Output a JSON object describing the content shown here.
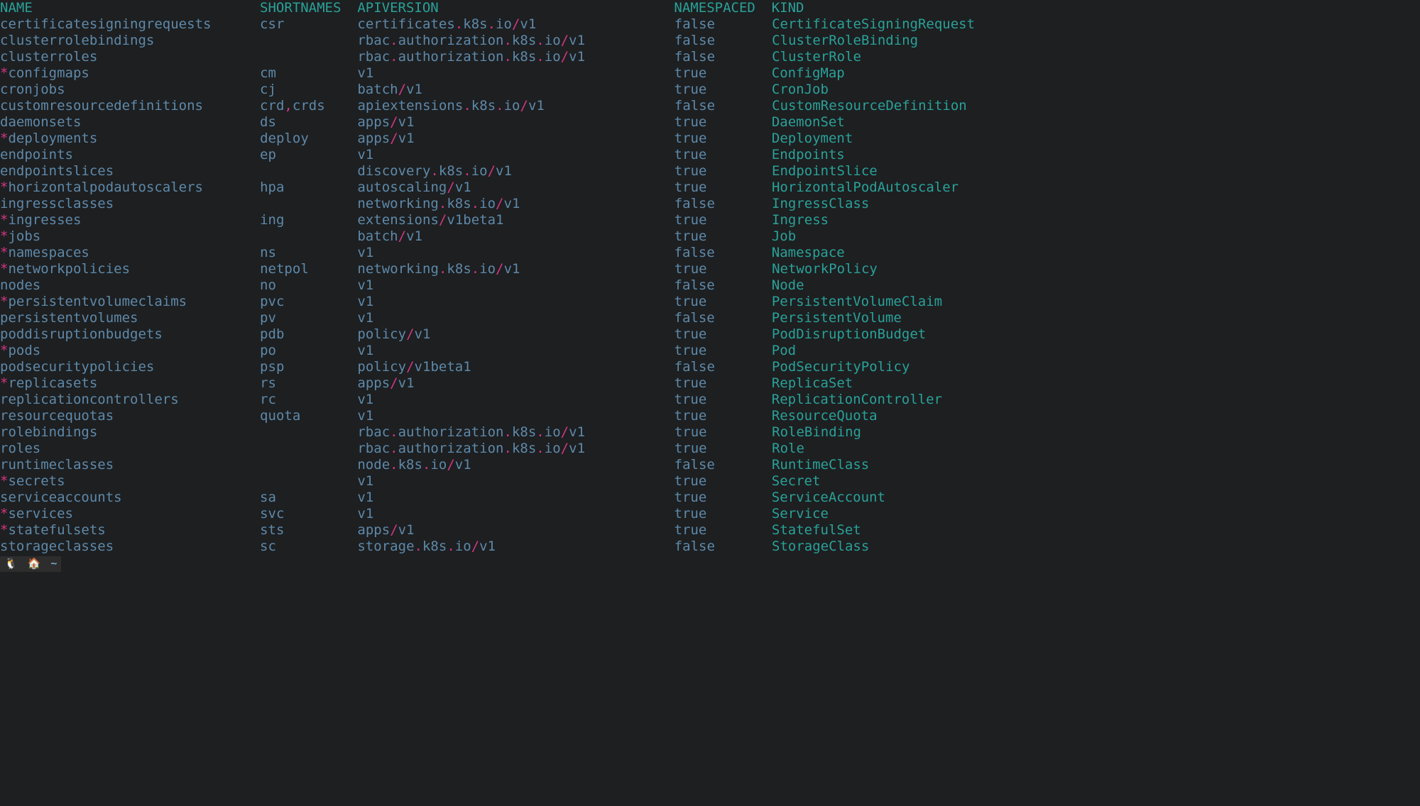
{
  "columns": {
    "name": "NAME",
    "shortnames": "SHORTNAMES",
    "apiversion": "APIVERSION",
    "namespaced": "NAMESPACED",
    "kind": "KIND"
  },
  "col_starts": {
    "name": 0,
    "short": 32,
    "api": 44,
    "ns": 83,
    "kind": 95
  },
  "rows": [
    {
      "star": false,
      "name": "certificatesigningrequests",
      "short": "csr",
      "api": "certificates.k8s.io/v1",
      "ns": "false",
      "kind": "CertificateSigningRequest"
    },
    {
      "star": false,
      "name": "clusterrolebindings",
      "short": "",
      "api": "rbac.authorization.k8s.io/v1",
      "ns": "false",
      "kind": "ClusterRoleBinding"
    },
    {
      "star": false,
      "name": "clusterroles",
      "short": "",
      "api": "rbac.authorization.k8s.io/v1",
      "ns": "false",
      "kind": "ClusterRole"
    },
    {
      "star": true,
      "name": "configmaps",
      "short": "cm",
      "api": "v1",
      "ns": "true",
      "kind": "ConfigMap"
    },
    {
      "star": false,
      "name": "cronjobs",
      "short": "cj",
      "api": "batch/v1",
      "ns": "true",
      "kind": "CronJob"
    },
    {
      "star": false,
      "name": "customresourcedefinitions",
      "short": "crd,crds",
      "api": "apiextensions.k8s.io/v1",
      "ns": "false",
      "kind": "CustomResourceDefinition"
    },
    {
      "star": false,
      "name": "daemonsets",
      "short": "ds",
      "api": "apps/v1",
      "ns": "true",
      "kind": "DaemonSet"
    },
    {
      "star": true,
      "name": "deployments",
      "short": "deploy",
      "api": "apps/v1",
      "ns": "true",
      "kind": "Deployment"
    },
    {
      "star": false,
      "name": "endpoints",
      "short": "ep",
      "api": "v1",
      "ns": "true",
      "kind": "Endpoints"
    },
    {
      "star": false,
      "name": "endpointslices",
      "short": "",
      "api": "discovery.k8s.io/v1",
      "ns": "true",
      "kind": "EndpointSlice"
    },
    {
      "star": true,
      "name": "horizontalpodautoscalers",
      "short": "hpa",
      "api": "autoscaling/v1",
      "ns": "true",
      "kind": "HorizontalPodAutoscaler"
    },
    {
      "star": false,
      "name": "ingressclasses",
      "short": "",
      "api": "networking.k8s.io/v1",
      "ns": "false",
      "kind": "IngressClass"
    },
    {
      "star": true,
      "name": "ingresses",
      "short": "ing",
      "api": "extensions/v1beta1",
      "ns": "true",
      "kind": "Ingress"
    },
    {
      "star": true,
      "name": "jobs",
      "short": "",
      "api": "batch/v1",
      "ns": "true",
      "kind": "Job"
    },
    {
      "star": true,
      "name": "namespaces",
      "short": "ns",
      "api": "v1",
      "ns": "false",
      "kind": "Namespace"
    },
    {
      "star": true,
      "name": "networkpolicies",
      "short": "netpol",
      "api": "networking.k8s.io/v1",
      "ns": "true",
      "kind": "NetworkPolicy"
    },
    {
      "star": false,
      "name": "nodes",
      "short": "no",
      "api": "v1",
      "ns": "false",
      "kind": "Node"
    },
    {
      "star": true,
      "name": "persistentvolumeclaims",
      "short": "pvc",
      "api": "v1",
      "ns": "true",
      "kind": "PersistentVolumeClaim"
    },
    {
      "star": false,
      "name": "persistentvolumes",
      "short": "pv",
      "api": "v1",
      "ns": "false",
      "kind": "PersistentVolume"
    },
    {
      "star": false,
      "name": "poddisruptionbudgets",
      "short": "pdb",
      "api": "policy/v1",
      "ns": "true",
      "kind": "PodDisruptionBudget"
    },
    {
      "star": true,
      "name": "pods",
      "short": "po",
      "api": "v1",
      "ns": "true",
      "kind": "Pod"
    },
    {
      "star": false,
      "name": "podsecuritypolicies",
      "short": "psp",
      "api": "policy/v1beta1",
      "ns": "false",
      "kind": "PodSecurityPolicy"
    },
    {
      "star": true,
      "name": "replicasets",
      "short": "rs",
      "api": "apps/v1",
      "ns": "true",
      "kind": "ReplicaSet"
    },
    {
      "star": false,
      "name": "replicationcontrollers",
      "short": "rc",
      "api": "v1",
      "ns": "true",
      "kind": "ReplicationController"
    },
    {
      "star": false,
      "name": "resourcequotas",
      "short": "quota",
      "api": "v1",
      "ns": "true",
      "kind": "ResourceQuota"
    },
    {
      "star": false,
      "name": "rolebindings",
      "short": "",
      "api": "rbac.authorization.k8s.io/v1",
      "ns": "true",
      "kind": "RoleBinding"
    },
    {
      "star": false,
      "name": "roles",
      "short": "",
      "api": "rbac.authorization.k8s.io/v1",
      "ns": "true",
      "kind": "Role"
    },
    {
      "star": false,
      "name": "runtimeclasses",
      "short": "",
      "api": "node.k8s.io/v1",
      "ns": "false",
      "kind": "RuntimeClass"
    },
    {
      "star": true,
      "name": "secrets",
      "short": "",
      "api": "v1",
      "ns": "true",
      "kind": "Secret"
    },
    {
      "star": false,
      "name": "serviceaccounts",
      "short": "sa",
      "api": "v1",
      "ns": "true",
      "kind": "ServiceAccount"
    },
    {
      "star": true,
      "name": "services",
      "short": "svc",
      "api": "v1",
      "ns": "true",
      "kind": "Service"
    },
    {
      "star": true,
      "name": "statefulsets",
      "short": "sts",
      "api": "apps/v1",
      "ns": "true",
      "kind": "StatefulSet"
    },
    {
      "star": false,
      "name": "storageclasses",
      "short": "sc",
      "api": "storage.k8s.io/v1",
      "ns": "false",
      "kind": "StorageClass"
    }
  ],
  "statusbar": {
    "tux": "🐧",
    "home_icon": "🏠",
    "tilde": "~"
  }
}
